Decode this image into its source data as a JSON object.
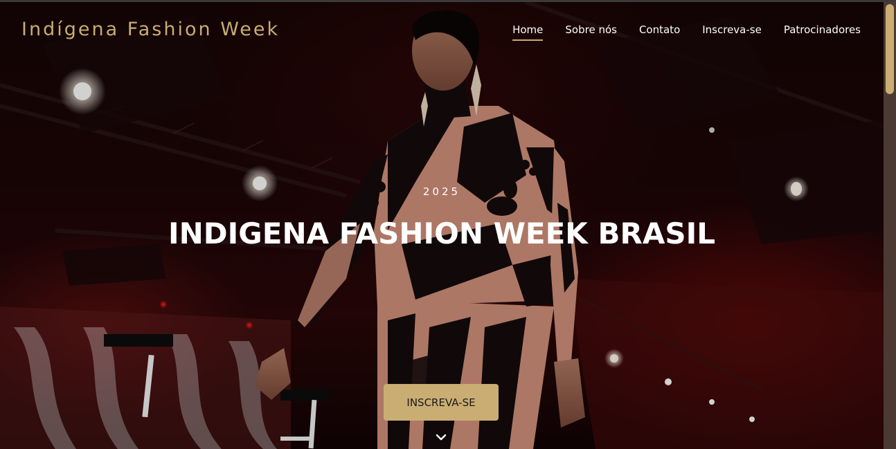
{
  "header": {
    "brand": "Indígena Fashion Week",
    "nav": [
      {
        "label": "Home",
        "active": true
      },
      {
        "label": "Sobre nós",
        "active": false
      },
      {
        "label": "Contato",
        "active": false
      },
      {
        "label": "Inscreva-se",
        "active": false
      },
      {
        "label": "Patrocinadores",
        "active": false
      }
    ]
  },
  "hero": {
    "year": "2025",
    "title": "INDIGENA FASHION WEEK BRASIL",
    "cta_label": "INSCREVA-SE",
    "scroll_icon": "chevron-down-icon",
    "background_image": "runway model in pink and black patterned dress under stage lights"
  },
  "colors": {
    "accent": "#c9ad72",
    "text": "#ffffff",
    "scrollbar_track": "#4a3a33"
  }
}
